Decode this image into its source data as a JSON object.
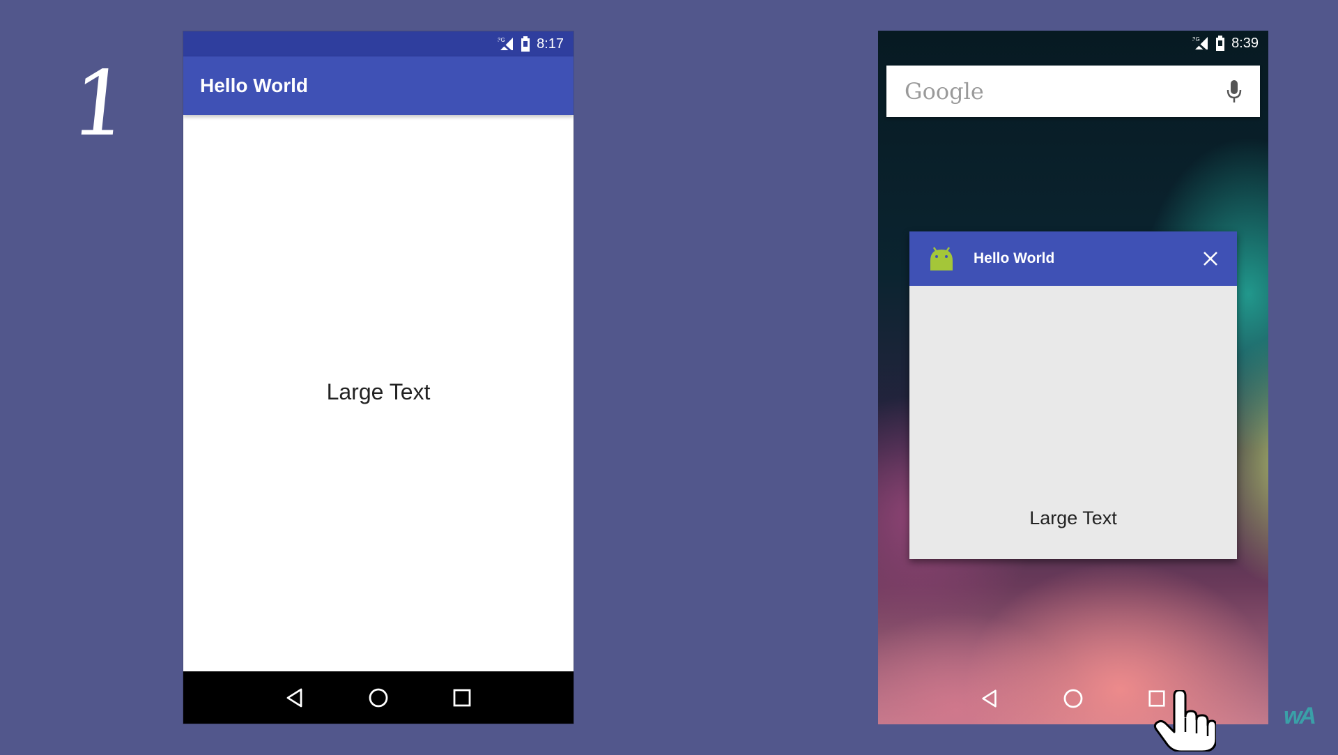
{
  "slide": {
    "number": "1"
  },
  "phone1": {
    "status": {
      "signal": "3G",
      "time": "8:17"
    },
    "appbar_title": "Hello World",
    "content_text": "Large Text",
    "nav": [
      "back",
      "home",
      "recents"
    ]
  },
  "phone2": {
    "status": {
      "signal": "3G",
      "time": "8:39"
    },
    "search": {
      "logo_text": "Google",
      "mic_icon": "mic-icon"
    },
    "recent_app": {
      "title": "Hello World",
      "icon": "android-icon",
      "close_icon": "close-icon",
      "preview_text": "Large Text"
    },
    "nav": [
      "back",
      "home",
      "recents"
    ]
  },
  "watermark": {
    "text": "wA"
  },
  "colors": {
    "background": "#52578c",
    "primary": "#3f51b5",
    "primary_dark": "#2f3e9e",
    "android_green": "#a4c639"
  }
}
